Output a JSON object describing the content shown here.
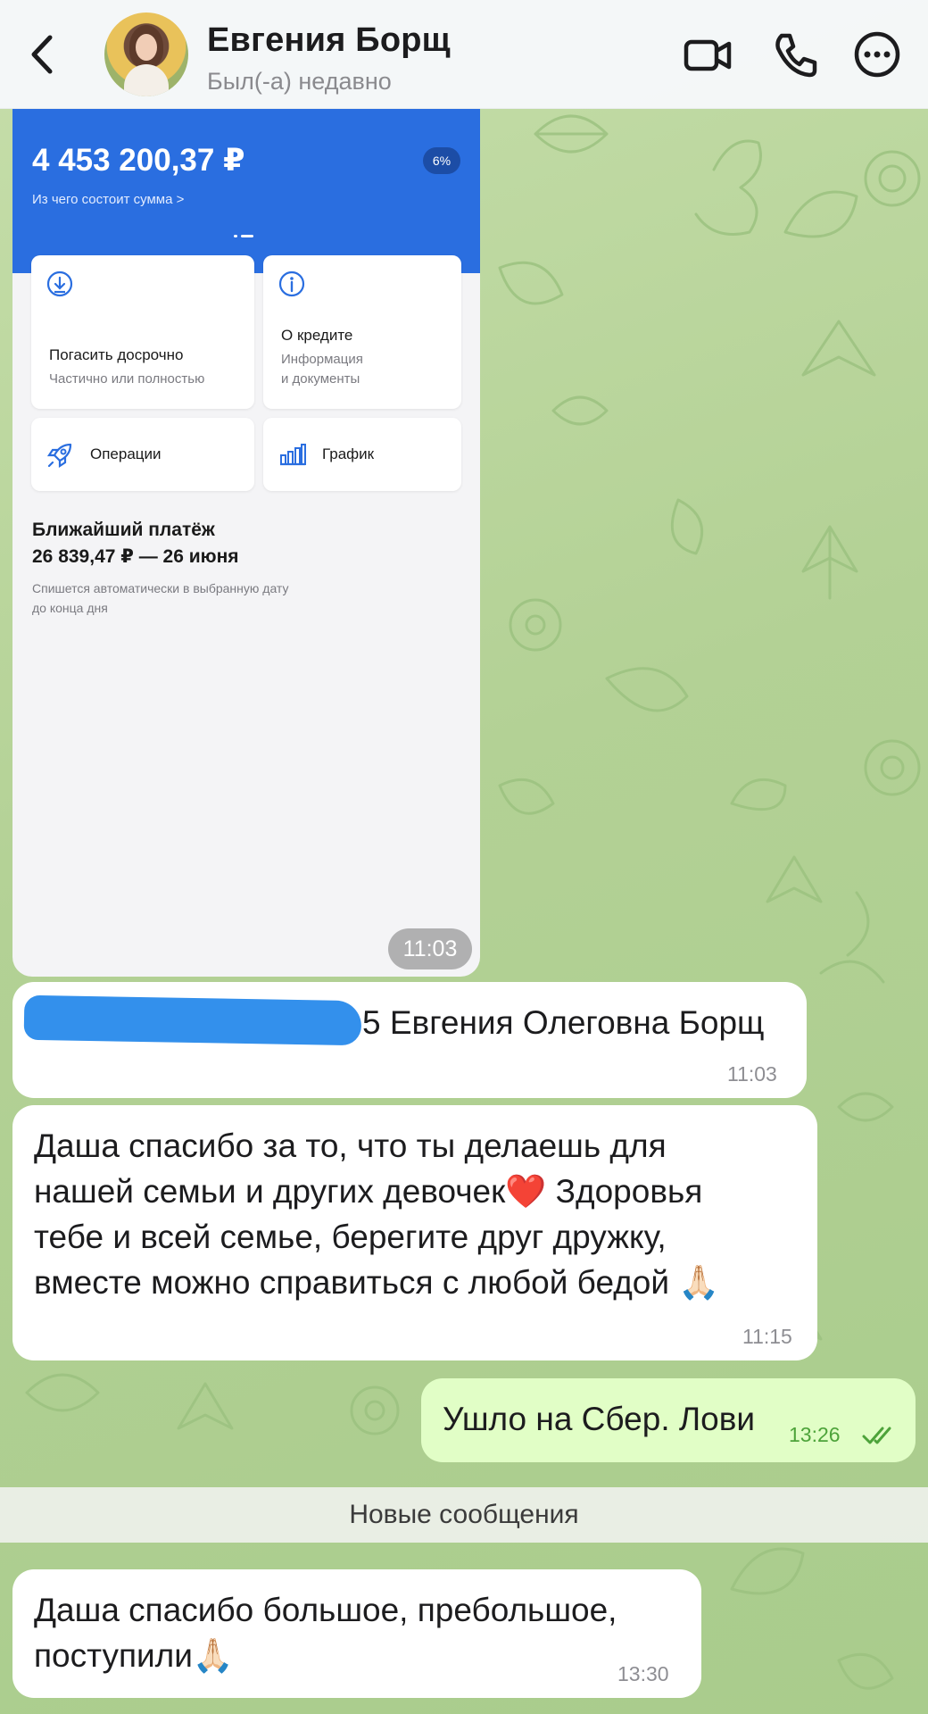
{
  "header": {
    "contact_name": "Евгения Борщ",
    "status": "Был(-а) недавно",
    "icons": [
      "back-chevron-icon",
      "video-call-icon",
      "phone-icon",
      "more-icon"
    ]
  },
  "screenshot": {
    "amount": "4 453 200,37 ₽",
    "amount_link": "Из чего состоит сумма >",
    "rate_badge": "6%",
    "cards": {
      "repay": {
        "title": "Погасить досрочно",
        "sub": "Частично или полностью",
        "icon": "download-icon"
      },
      "about": {
        "title": "О кредите",
        "sub": "Информация\nи документы",
        "icon": "info-icon"
      },
      "operations": {
        "title": "Операции",
        "icon": "rocket-icon"
      },
      "schedule": {
        "title": "График",
        "icon": "bar-chart-icon"
      }
    },
    "next_payment": {
      "title": "Ближайший платёж",
      "value": "26 839,47 ₽ — 26 июня",
      "note": "Спишется автоматически в выбранную дату\nдо конца дня"
    },
    "time": "11:03"
  },
  "messages": [
    {
      "id": "m1",
      "direction": "in",
      "text": "5 Евгения Олеговна Борщ",
      "time": "11:03"
    },
    {
      "id": "m2",
      "direction": "in",
      "text": "Даша спасибо за то, что ты делаешь для\nнашей семьи и других девочек❤️ Здоровья\nтебе и всей семье, берегите друг дружку,\nвместе можно справиться с любой бедой 🙏🏻",
      "time": "11:15"
    },
    {
      "id": "m3",
      "direction": "out",
      "text": "Ушло на Сбер. Лови",
      "time": "13:26"
    },
    {
      "id": "m4",
      "direction": "in",
      "text": "Даша спасибо большое, пребольшое,\nпоступили🙏🏻",
      "time": "13:30"
    }
  ],
  "new_messages_label": "Новые сообщения",
  "colors": {
    "chat_bg": "#b3d195",
    "bank_blue": "#2a6ee0",
    "outgoing_bubble": "#e1fec6",
    "read_check": "#4da33a",
    "redaction": "#3390ec"
  }
}
